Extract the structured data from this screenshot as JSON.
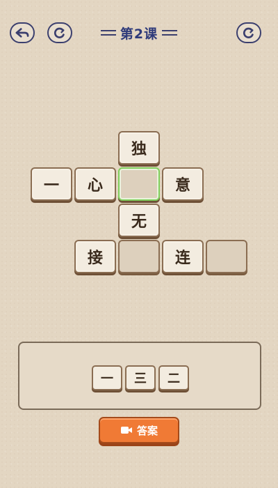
{
  "header": {
    "title": "第2课",
    "icons": {
      "back": "back-arrow-icon",
      "restart": "restart-icon",
      "refresh": "refresh-icon"
    }
  },
  "board": {
    "tiles": {
      "du": "独",
      "yi": "一",
      "xin": "心",
      "blank_center": "",
      "yi_meaning": "意",
      "wu": "无",
      "jie": "接",
      "blank_bottom": "",
      "lian": "连",
      "blank_right": ""
    }
  },
  "choices": [
    "一",
    "三",
    "二"
  ],
  "answer_button": {
    "label": "答案",
    "icon": "video-icon"
  },
  "colors": {
    "accent": "#f07a35",
    "selected": "#7fcf5c",
    "title": "#2e3a7a"
  }
}
